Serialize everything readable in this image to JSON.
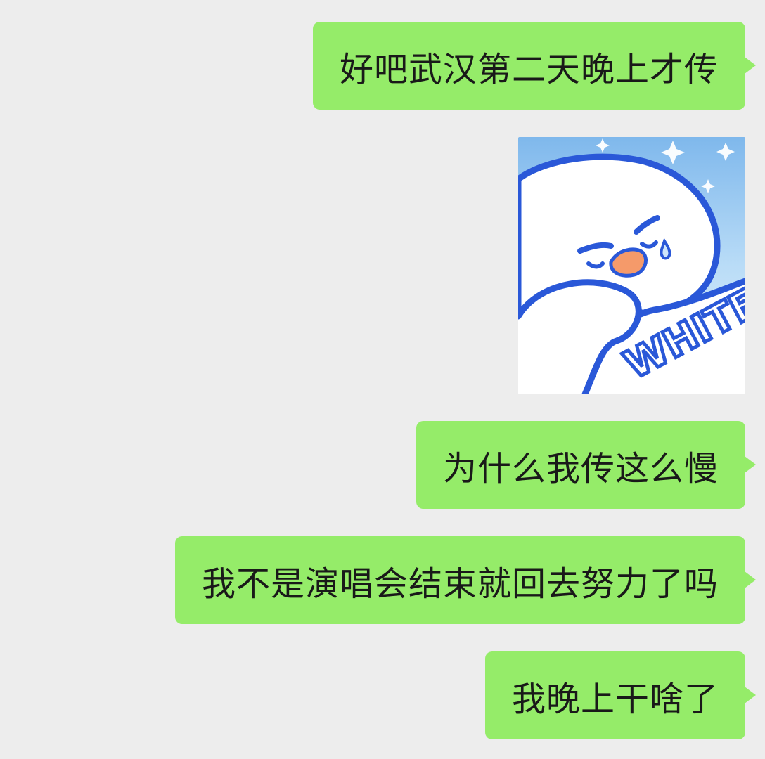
{
  "chat": {
    "messages": [
      {
        "type": "text",
        "sender": "me",
        "text": "好吧武汉第二天晚上才传"
      },
      {
        "type": "sticker",
        "sender": "me",
        "sticker_text": "WHITE"
      },
      {
        "type": "text",
        "sender": "me",
        "text": "为什么我传这么慢"
      },
      {
        "type": "text",
        "sender": "me",
        "text": "我不是演唱会结束就回去努力了吗"
      },
      {
        "type": "text",
        "sender": "me",
        "text": "我晚上干啥了"
      }
    ]
  },
  "colors": {
    "background": "#ededed",
    "bubble": "#95ec69",
    "text": "#191919",
    "sticker_outline": "#2a58d8",
    "sticker_beak": "#f59a6a",
    "sticker_sky": "#8cc4f2"
  }
}
